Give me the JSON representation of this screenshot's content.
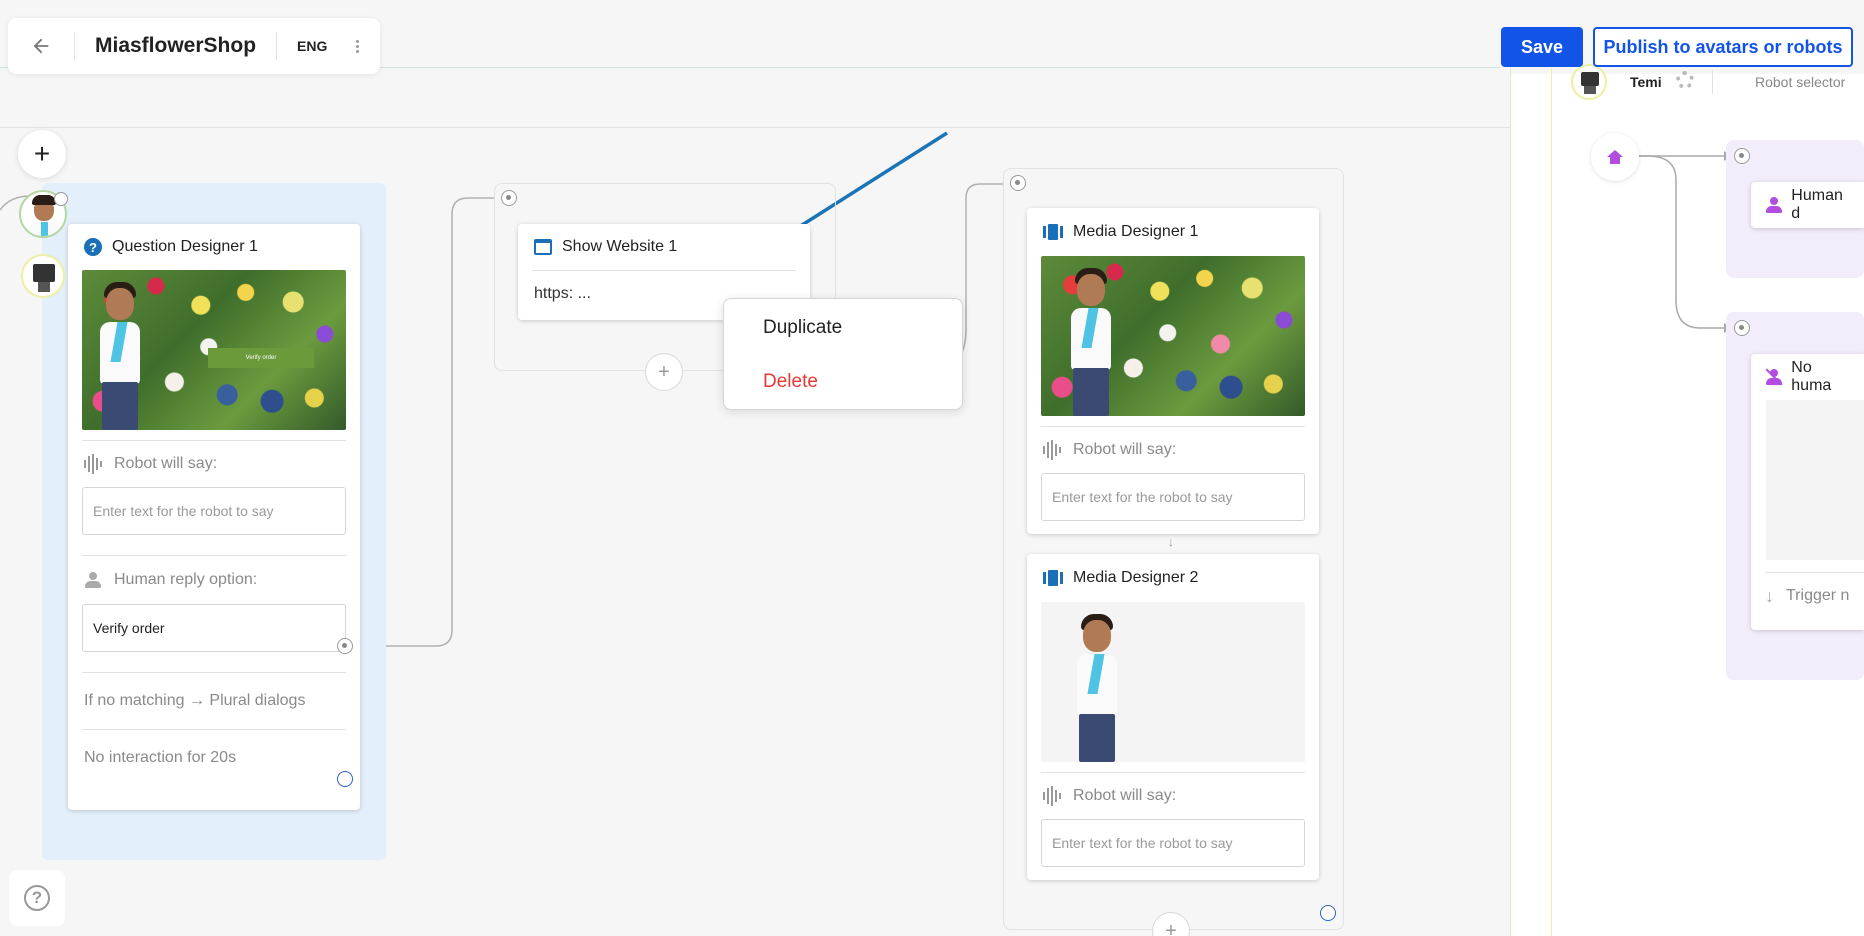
{
  "toolbar": {
    "project_name": "MiasflowerShop",
    "language": "ENG",
    "save_label": "Save",
    "publish_label": "Publish to avatars or robots"
  },
  "question_card": {
    "title": "Question Designer 1",
    "image_button_text": "Verify order",
    "robot_say_label": "Robot will say:",
    "robot_say_placeholder": "Enter text for the robot to say",
    "human_reply_label": "Human reply option:",
    "reply_value": "Verify order",
    "no_match_text": "If no matching → Plural dialogs",
    "no_interaction_text": "No interaction for 20s"
  },
  "website_card": {
    "title": "Show Website 1",
    "url": "https: ..."
  },
  "context_menu": {
    "duplicate_label": "Duplicate",
    "delete_label": "Delete"
  },
  "media_card_1": {
    "title": "Media Designer 1",
    "robot_say_label": "Robot will say:",
    "robot_say_placeholder": "Enter text for the robot to say"
  },
  "media_card_2": {
    "title": "Media Designer 2",
    "robot_say_label": "Robot will say:",
    "robot_say_placeholder": "Enter text for the robot to say"
  },
  "connector_arrow": "↓",
  "right_panel": {
    "robot_name": "Temi",
    "robot_selector_label": "Robot selector",
    "human_card_title": "Human d",
    "no_human_card_title": "No huma",
    "trigger_text": "Trigger n"
  },
  "colors": {
    "primary": "#1254e8",
    "delete": "#e53935",
    "card_icon_blue": "#1a6fb7",
    "purple_accent": "#b24de0",
    "annotation_arrow": "#1a74b8"
  },
  "icons": [
    "back-arrow-icon",
    "kebab-icon",
    "plus-icon",
    "help-icon",
    "question-icon",
    "browser-window-icon",
    "media-icon",
    "sound-wave-icon",
    "person-icon",
    "gear-icon",
    "home-icon",
    "person-off-icon",
    "down-arrow-icon"
  ]
}
